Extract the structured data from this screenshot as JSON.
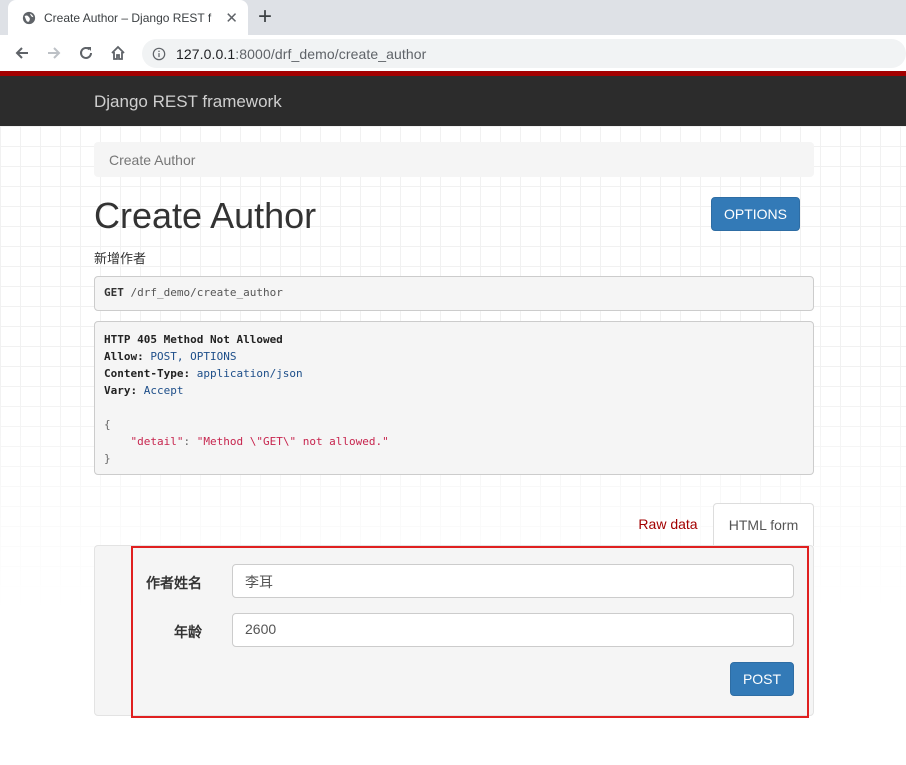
{
  "browser": {
    "tab_title": "Create Author – Django REST f",
    "url_host": "127.0.0.1",
    "url_rest": ":8000/drf_demo/create_author"
  },
  "navbar": {
    "brand": "Django REST framework"
  },
  "breadcrumb": {
    "label": "Create Author"
  },
  "page": {
    "title": "Create Author",
    "description": "新增作者",
    "options_label": "OPTIONS"
  },
  "request": {
    "method": "GET",
    "path": "/drf_demo/create_author"
  },
  "response": {
    "status_line": "HTTP 405 Method Not Allowed",
    "headers": [
      {
        "name": "Allow:",
        "value": "POST, OPTIONS"
      },
      {
        "name": "Content-Type:",
        "value": "application/json"
      },
      {
        "name": "Vary:",
        "value": "Accept"
      }
    ],
    "body_open": "{",
    "body_key": "\"detail\"",
    "body_colon": ": ",
    "body_value": "\"Method \\\"GET\\\" not allowed.\"",
    "body_close": "}"
  },
  "tabs": {
    "raw_data": "Raw data",
    "html_form": "HTML form"
  },
  "form": {
    "name_label": "作者姓名",
    "name_value": "李耳",
    "age_label": "年龄",
    "age_value": "2600",
    "submit_label": "POST"
  },
  "colors": {
    "brand_red": "#a30000",
    "primary": "#337ab7",
    "highlight_border": "#e02020"
  },
  "icons": [
    "globe-icon",
    "close-icon",
    "plus-icon",
    "back-arrow-icon",
    "forward-arrow-icon",
    "reload-icon",
    "home-icon",
    "info-icon"
  ]
}
